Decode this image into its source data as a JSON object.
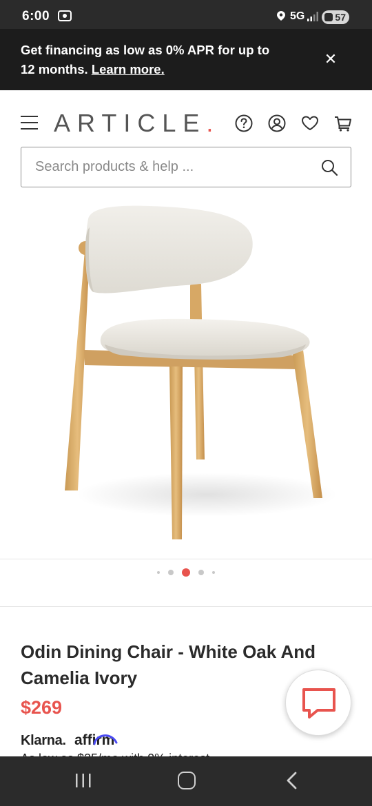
{
  "status_bar": {
    "time": "6:00",
    "network": "5G",
    "battery": "57"
  },
  "promo": {
    "text": "Get financing as low as 0% APR for up to 12 months.",
    "link": "Learn more.",
    "close": "✕"
  },
  "header": {
    "logo": "ARTICLE",
    "logo_dot": ".",
    "icons": [
      "menu-icon",
      "help-icon",
      "account-icon",
      "wishlist-icon",
      "cart-icon"
    ]
  },
  "search": {
    "placeholder": "Search products & help ..."
  },
  "product": {
    "title": "Odin Dining Chair - White Oak And Camelia Ivory",
    "price": "$269",
    "gallery_active_index": 2,
    "gallery_count": 5,
    "payment_partners": {
      "klarna": "Klarna.",
      "affirm": "affirm"
    },
    "installment_text": "As low as $25/mo with 0% interest"
  },
  "colors": {
    "accent": "#e8544e",
    "banner": "#1c1c1c",
    "system_bar": "#2b2b2b"
  }
}
